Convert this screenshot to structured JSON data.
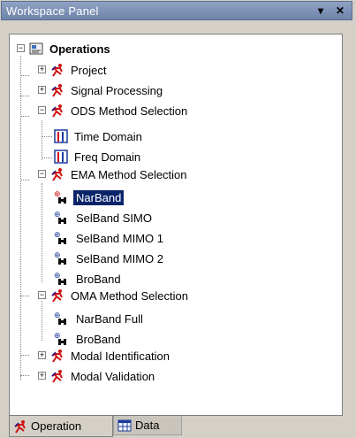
{
  "window": {
    "title": "Workspace Panel",
    "pin_glyph": "▾",
    "close_glyph": "✕"
  },
  "tree": {
    "root": "Operations",
    "items": [
      {
        "label": "Project",
        "expanded": false
      },
      {
        "label": "Signal Processing",
        "expanded": false
      },
      {
        "label": "ODS Method Selection",
        "expanded": true,
        "children": [
          "Time Domain",
          "Freq Domain"
        ]
      },
      {
        "label": "EMA Method Selection",
        "expanded": true,
        "children": [
          "NarBand",
          "SelBand SIMO",
          "SelBand MIMO 1",
          "SelBand MIMO 2",
          "BroBand"
        ],
        "selected_child": "NarBand"
      },
      {
        "label": "OMA Method Selection",
        "expanded": true,
        "children": [
          "NarBand Full",
          "BroBand"
        ]
      },
      {
        "label": "Modal Identification",
        "expanded": false
      },
      {
        "label": "Modal Validation",
        "expanded": false
      }
    ]
  },
  "tabs": {
    "operation": "Operation",
    "data": "Data"
  },
  "icons": {
    "expand": "+",
    "collapse": "−"
  },
  "colors": {
    "selection": "#0a246a",
    "title_bar": "#7d8fb3"
  }
}
